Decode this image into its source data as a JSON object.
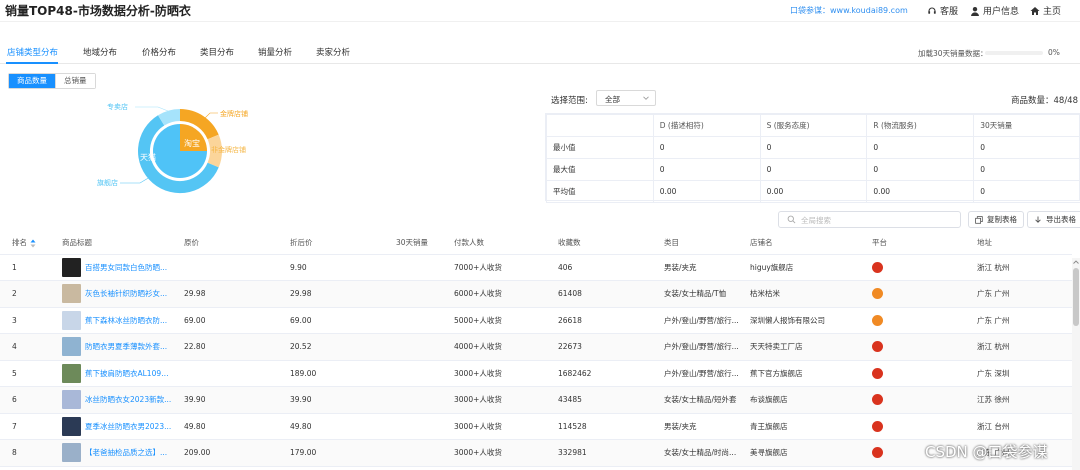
{
  "header": {
    "title": "销量TOP48-市场数据分析-防晒衣",
    "koudai_link": "口袋参谋：www.koudai89.com",
    "service_label": "客服",
    "user_label": "用户信息",
    "home_label": "主页"
  },
  "tabs": [
    {
      "label": "店铺类型分布"
    },
    {
      "label": "地域分布"
    },
    {
      "label": "价格分布"
    },
    {
      "label": "类目分布"
    },
    {
      "label": "销量分析"
    },
    {
      "label": "卖家分析"
    }
  ],
  "loading": {
    "label": "加载30天销量数据：",
    "percent_text": "0%",
    "progress": 0
  },
  "toggle": {
    "option1": "商品数量",
    "option2": "总销量"
  },
  "donut": {
    "inner_taobao": "淘宝",
    "inner_tmall": "天猫",
    "label_jinpai": "金牌店铺",
    "label_feijinpai": "非金牌店铺",
    "label_qijian": "旗舰店",
    "label_zhuanmai": "专卖店",
    "colors": {
      "tmall": "#4fc3f7",
      "taobao": "#f5a623",
      "feijinpai": "#fbd59a",
      "qijian": "#54c5f4",
      "zhuanmai": "#a6e3fb"
    }
  },
  "filter": {
    "range_label": "选择范围:",
    "range_value": "全部",
    "count_label": "商品数量：48/48"
  },
  "stats": {
    "headers": [
      "",
      "D (描述相符)",
      "S (服务态度)",
      "R (物流服务)",
      "30天销量"
    ],
    "rows": [
      [
        "最小值",
        "0",
        "0",
        "0",
        "0"
      ],
      [
        "最大值",
        "0",
        "0",
        "0",
        "0"
      ],
      [
        "平均值",
        "0.00",
        "0.00",
        "0.00",
        "0"
      ]
    ]
  },
  "toolbar": {
    "search_placeholder": "全局搜索",
    "copy_label": "复制表格",
    "export_label": "导出表格"
  },
  "table": {
    "headers": [
      "排名",
      "商品标题",
      "原价",
      "折后价",
      "30天销量",
      "付款人数",
      "收藏数",
      "类目",
      "店铺名",
      "平台",
      "地址"
    ],
    "rows": [
      {
        "rank": "1",
        "title": "百搭男女同款白色防晒...",
        "orig": "",
        "disc": "9.90",
        "sales": "",
        "payers": "7000+人收货",
        "fav": "406",
        "cat": "男装/夹克",
        "shop": "higuy旗舰店",
        "platform": "tmall",
        "addr": "浙江 杭州",
        "thumb": "#222"
      },
      {
        "rank": "2",
        "title": "灰色长袖针织防晒衫女...",
        "orig": "29.98",
        "disc": "29.98",
        "sales": "",
        "payers": "6000+人收货",
        "fav": "61408",
        "cat": "女装/女士精品/T恤",
        "shop": "枯米枯米",
        "platform": "taobao",
        "addr": "广东 广州",
        "thumb": "#c9b9a0"
      },
      {
        "rank": "3",
        "title": "蕉下森林冰丝防晒衣防...",
        "orig": "69.00",
        "disc": "69.00",
        "sales": "",
        "payers": "5000+人收货",
        "fav": "26618",
        "cat": "户外/登山/野营/旅行...",
        "shop": "深圳懒人报饰有限公司",
        "platform": "taobao",
        "addr": "广东 广州",
        "thumb": "#c8d6e8"
      },
      {
        "rank": "4",
        "title": "防晒衣男夏季薄款外套...",
        "orig": "22.80",
        "disc": "20.52",
        "sales": "",
        "payers": "4000+人收货",
        "fav": "22673",
        "cat": "户外/登山/野营/旅行...",
        "shop": "天天特卖工厂店",
        "platform": "tmall",
        "addr": "浙江 杭州",
        "thumb": "#8fb3d1"
      },
      {
        "rank": "5",
        "title": "蕉下披肩防晒衣AL109女...",
        "orig": "",
        "disc": "189.00",
        "sales": "",
        "payers": "3000+人收货",
        "fav": "1682462",
        "cat": "户外/登山/野营/旅行...",
        "shop": "蕉下官方旗舰店",
        "platform": "tmall",
        "addr": "广东 深圳",
        "thumb": "#6d8a5a"
      },
      {
        "rank": "6",
        "title": "冰丝防晒衣女2023新款...",
        "orig": "39.90",
        "disc": "39.90",
        "sales": "",
        "payers": "3000+人收货",
        "fav": "43485",
        "cat": "女装/女士精品/短外套",
        "shop": "布谈旗舰店",
        "platform": "tmall",
        "addr": "江苏 徐州",
        "thumb": "#a9b8d8"
      },
      {
        "rank": "7",
        "title": "夏季冰丝防晒衣男2023...",
        "orig": "49.80",
        "disc": "49.80",
        "sales": "",
        "payers": "3000+人收货",
        "fav": "114528",
        "cat": "男装/夹克",
        "shop": "青王旗舰店",
        "platform": "tmall",
        "addr": "浙江 台州",
        "thumb": "#2b3a55"
      },
      {
        "rank": "8",
        "title": "【老爸抽检品质之选】...",
        "orig": "209.00",
        "disc": "179.00",
        "sales": "",
        "payers": "3000+人收货",
        "fav": "332981",
        "cat": "女装/女士精品/时尚...",
        "shop": "美寻旗舰店",
        "platform": "tmall",
        "addr": "广东 广州",
        "thumb": "#9ab0c9"
      }
    ]
  },
  "watermark": "CSDN @口袋参谋"
}
